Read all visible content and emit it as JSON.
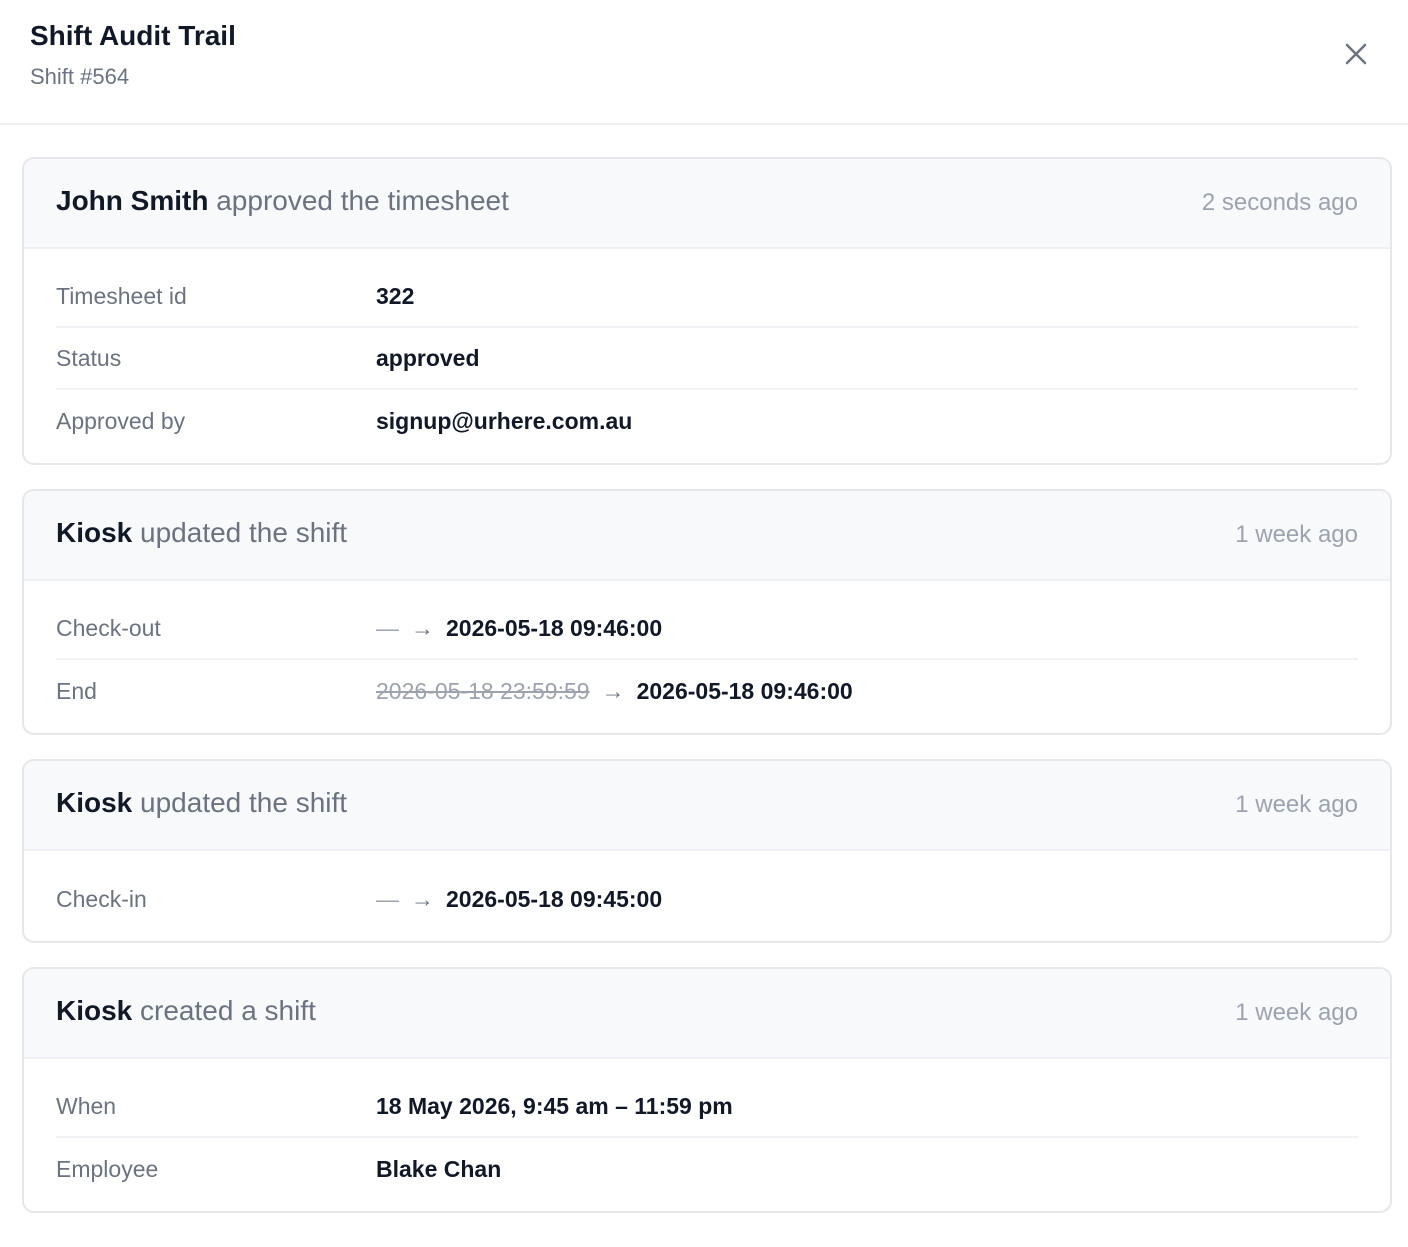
{
  "header": {
    "title": "Shift Audit Trail",
    "subtitle": "Shift #564"
  },
  "entries": [
    {
      "actor": "John Smith",
      "action": "approved the timesheet",
      "time": "2 seconds ago",
      "fields": [
        {
          "label": "Timesheet id",
          "value": "322"
        },
        {
          "label": "Status",
          "value": "approved"
        },
        {
          "label": "Approved by",
          "value": "signup@urhere.com.au"
        }
      ]
    },
    {
      "actor": "Kiosk",
      "action": "updated the shift",
      "time": "1 week ago",
      "fields": [
        {
          "label": "Check-out",
          "old": "—",
          "arrow": "→",
          "new": "2026-05-18 09:46:00"
        },
        {
          "label": "End",
          "old": "2026-05-18 23:59:59",
          "arrow": "→",
          "new": "2026-05-18 09:46:00"
        }
      ]
    },
    {
      "actor": "Kiosk",
      "action": "updated the shift",
      "time": "1 week ago",
      "fields": [
        {
          "label": "Check-in",
          "old": "—",
          "arrow": "→",
          "new": "2026-05-18 09:45:00"
        }
      ]
    },
    {
      "actor": "Kiosk",
      "action": "created a shift",
      "time": "1 week ago",
      "fields": [
        {
          "label": "When",
          "value": "18 May 2026, 9:45 am – 11:59 pm"
        },
        {
          "label": "Employee",
          "value": "Blake Chan"
        }
      ]
    }
  ],
  "icons": {
    "close": "close-icon"
  },
  "colors": {
    "text_primary": "#111827",
    "text_muted": "#6b7280",
    "text_faint": "#9ca3af",
    "card_header_bg": "#f8f9fb",
    "border": "#e5e7eb"
  }
}
